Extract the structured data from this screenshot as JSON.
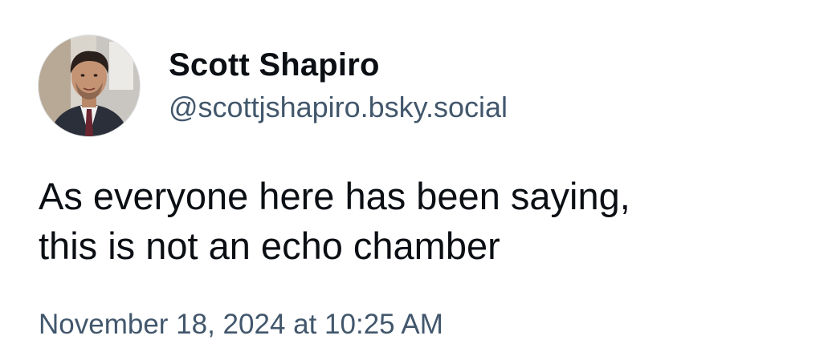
{
  "post": {
    "author": {
      "display_name": "Scott Shapiro",
      "handle": "@scottjshapiro.bsky.social",
      "avatar_icon": "profile-photo"
    },
    "text": "As everyone here has been saying,\nthis is not an echo chamber",
    "timestamp": "November 18, 2024 at 10:25 AM"
  },
  "colors": {
    "text_primary": "#0b0f14",
    "text_secondary": "#42576c",
    "background": "#ffffff"
  }
}
